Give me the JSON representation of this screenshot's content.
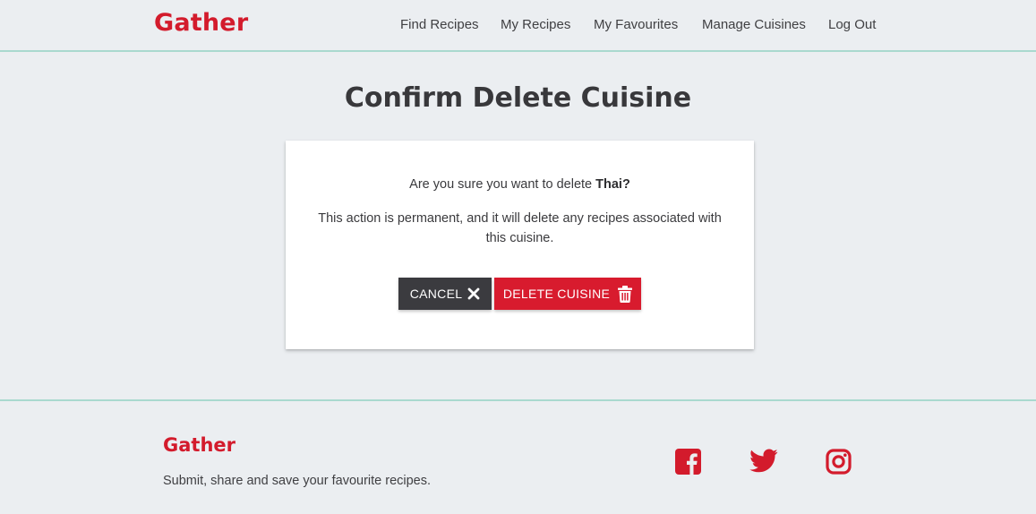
{
  "header": {
    "brand": "Gather",
    "nav": [
      {
        "label": "Find Recipes"
      },
      {
        "label": "My Recipes"
      },
      {
        "label": "My Favourites"
      },
      {
        "label": "Manage Cuisines"
      },
      {
        "label": "Log Out"
      }
    ]
  },
  "main": {
    "title": "Confirm Delete Cuisine",
    "card": {
      "question_prefix": "Are you sure you want to delete",
      "cuisine_name": "Thai?",
      "warning": "This action is permanent, and it will delete any recipes associated with this cuisine.",
      "cancel_label": "CANCEL",
      "cancel_icon": "close-icon",
      "delete_label": "DELETE CUISINE",
      "delete_icon": "trash-icon"
    }
  },
  "footer": {
    "brand": "Gather",
    "tagline": "Submit, share and save your favourite recipes.",
    "social": [
      {
        "icon": "facebook-icon"
      },
      {
        "icon": "twitter-icon"
      },
      {
        "icon": "instagram-icon"
      }
    ]
  },
  "colors": {
    "brand": "#d31b2c",
    "background": "#ebeef1",
    "accent_border": "#a9d9cf",
    "cancel_button": "#3b3b3f",
    "delete_button": "#d81b2e"
  }
}
